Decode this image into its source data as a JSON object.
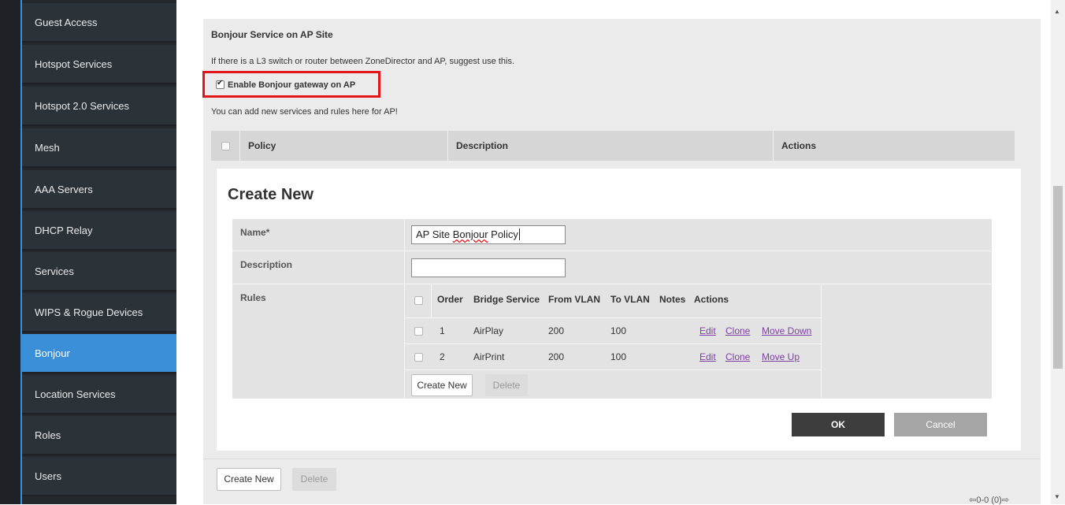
{
  "sidebar": {
    "items": [
      {
        "label": "Guest Access",
        "active": false
      },
      {
        "label": "Hotspot Services",
        "active": false
      },
      {
        "label": "Hotspot 2.0 Services",
        "active": false
      },
      {
        "label": "Mesh",
        "active": false
      },
      {
        "label": "AAA Servers",
        "active": false
      },
      {
        "label": "DHCP Relay",
        "active": false
      },
      {
        "label": "Services",
        "active": false
      },
      {
        "label": "WIPS & Rogue Devices",
        "active": false
      },
      {
        "label": "Bonjour",
        "active": true
      },
      {
        "label": "Location Services",
        "active": false
      },
      {
        "label": "Roles",
        "active": false
      },
      {
        "label": "Users",
        "active": false
      }
    ]
  },
  "section": {
    "title": "Bonjour Service on AP Site",
    "hint": "If there is a L3 switch or router between ZoneDirector and AP, suggest use this.",
    "checkbox_label": "Enable Bonjour gateway on AP",
    "checkbox_checked": true,
    "add_hint": "You can add new services and rules here for AP!",
    "table_headers": {
      "policy": "Policy",
      "description": "Description",
      "actions": "Actions"
    }
  },
  "dialog": {
    "title": "Create New",
    "name_label": "Name*",
    "name_value_prefix": "AP Site ",
    "name_value_misspelled": "Bonjour",
    "name_value_suffix": " Policy",
    "description_label": "Description",
    "description_value": "",
    "rules_label": "Rules",
    "rules_headers": {
      "order": "Order",
      "bridge_service": "Bridge Service",
      "from_vlan": "From VLAN",
      "to_vlan": "To VLAN",
      "notes": "Notes",
      "actions": "Actions"
    },
    "rules": [
      {
        "order": "1",
        "bridge_service": "AirPlay",
        "from_vlan": "200",
        "to_vlan": "100",
        "notes": "",
        "edit": "Edit",
        "clone": "Clone",
        "move": "Move Down"
      },
      {
        "order": "2",
        "bridge_service": "AirPrint",
        "from_vlan": "200",
        "to_vlan": "100",
        "notes": "",
        "edit": "Edit",
        "clone": "Clone",
        "move": "Move Up"
      }
    ],
    "create_new_label": "Create New",
    "delete_label": "Delete",
    "ok_label": "OK",
    "cancel_label": "Cancel"
  },
  "footer": {
    "create_new_label": "Create New",
    "delete_label": "Delete",
    "pager_text": "0-0 (0)"
  },
  "colors": {
    "accent": "#3a8fd8",
    "highlight_box": "#e0161b",
    "link": "#7b3fa0"
  }
}
